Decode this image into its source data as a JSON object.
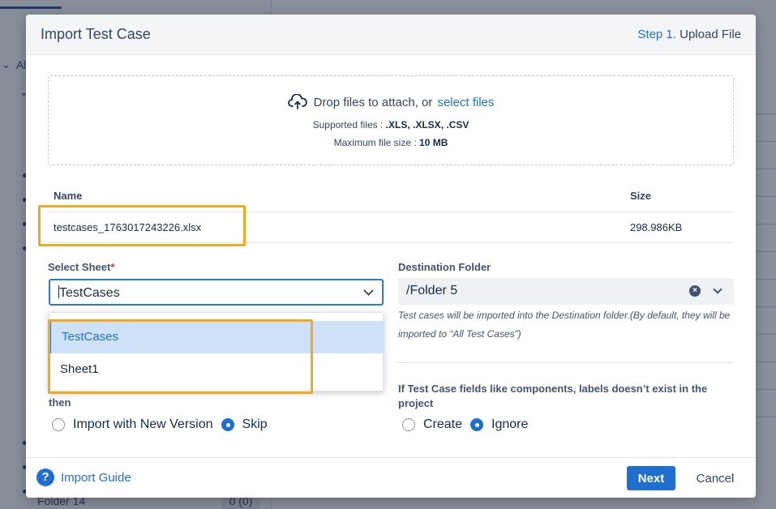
{
  "background": {
    "tree_label_partial": "Al",
    "folder_item": "Folder 14",
    "folder_count": "0 (0)"
  },
  "modal": {
    "title": "Import Test Case",
    "step_number": "Step 1.",
    "step_label": "Upload File"
  },
  "dropzone": {
    "text": "Drop files to attach, or",
    "link": "select files",
    "supported_prefix": "Supported files :",
    "supported_types": ".XLS, .XLSX, .CSV",
    "max_prefix": "Maximum file size :",
    "max_value": "10 MB",
    "icon": "cloud-upload-icon"
  },
  "file_table": {
    "headers": {
      "name": "Name",
      "size": "Size"
    },
    "rows": [
      {
        "name": "testcases_1763017243226.xlsx",
        "size": "298.986KB"
      }
    ]
  },
  "select_sheet": {
    "label": "Select Sheet",
    "required_mark": "*",
    "value": "TestCases",
    "options": [
      "TestCases",
      "Sheet1"
    ]
  },
  "destination": {
    "label": "Destination Folder",
    "value": "/Folder 5",
    "note": "Test cases will be imported into the Destination folder.(By default, they will be imported to “All Test Cases”)"
  },
  "existing_case": {
    "question_tail": "then",
    "options": [
      {
        "label": "Import with New Version",
        "selected": false
      },
      {
        "label": "Skip",
        "selected": true
      }
    ]
  },
  "missing_fields": {
    "question": "If Test Case fields like components, labels doesn’t exist in the project",
    "options": [
      {
        "label": "Create",
        "selected": false
      },
      {
        "label": "Ignore",
        "selected": true
      }
    ]
  },
  "footer": {
    "guide": "Import Guide",
    "next": "Next",
    "cancel": "Cancel"
  },
  "colors": {
    "accent": "#1f6fd1",
    "highlight": "#f1a91d"
  }
}
